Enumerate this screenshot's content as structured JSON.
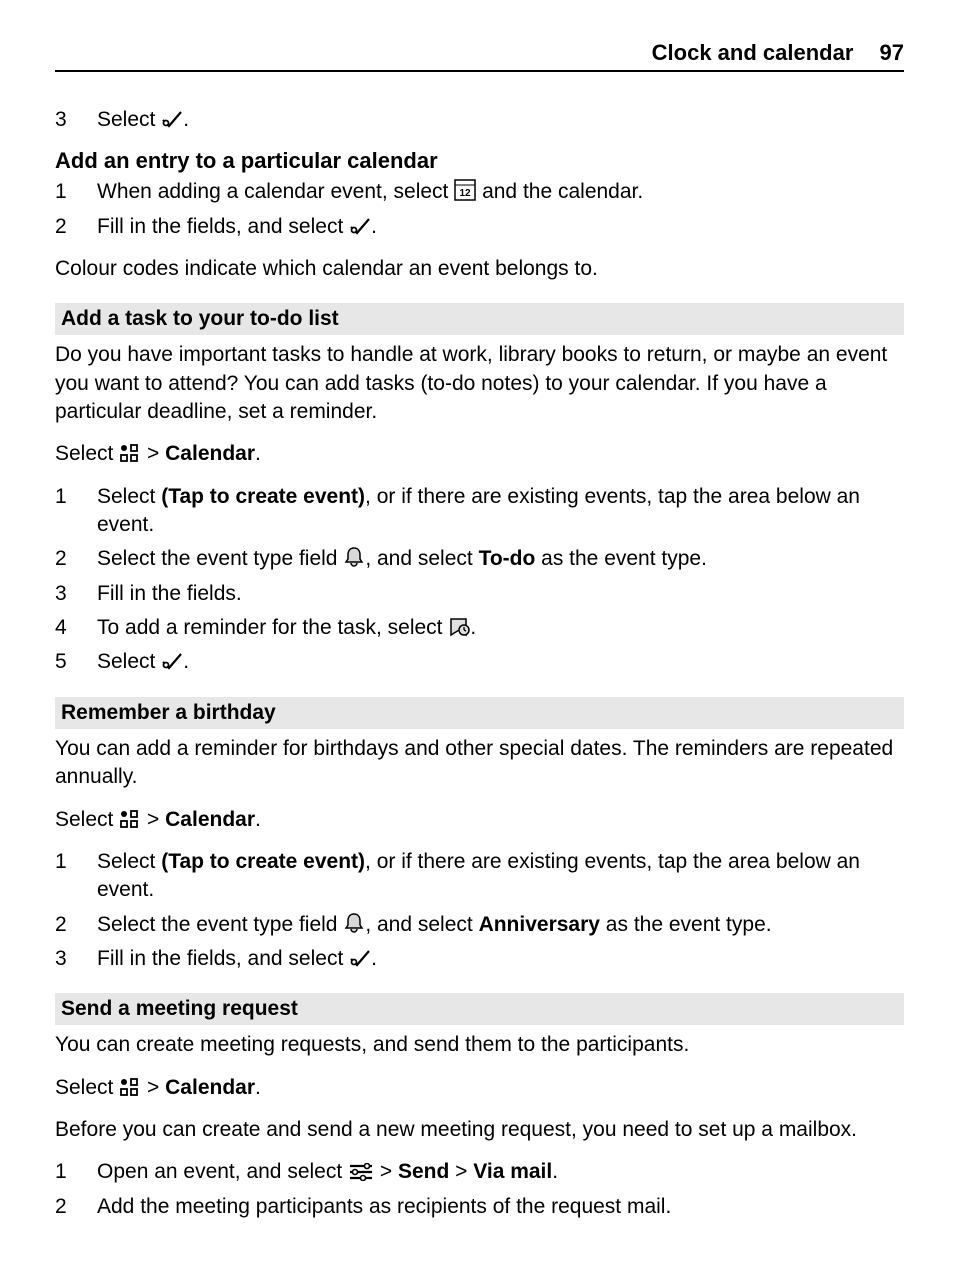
{
  "header": {
    "title": "Clock and calendar",
    "page": "97"
  },
  "pre_ol": [
    {
      "num": "3",
      "parts": [
        {
          "t": "Select "
        },
        {
          "icon": "check"
        },
        {
          "t": "."
        }
      ]
    }
  ],
  "add_entry_heading": "Add an entry to a particular calendar",
  "add_entry_ol": [
    {
      "num": "1",
      "parts": [
        {
          "t": "When adding a calendar event, select "
        },
        {
          "icon": "calendar12"
        },
        {
          "t": " and the calendar."
        }
      ]
    },
    {
      "num": "2",
      "parts": [
        {
          "t": "Fill in the fields, and select "
        },
        {
          "icon": "check"
        },
        {
          "t": "."
        }
      ]
    }
  ],
  "colour_para": "Colour codes indicate which calendar an event belongs to.",
  "task_heading": "Add a task to your to-do list",
  "task_para": "Do you have important tasks to handle at work, library books to return, or maybe an event you want to attend? You can add tasks (to-do notes) to your calendar. If you have a particular deadline, set a reminder.",
  "select_menu_calendar": [
    {
      "t": "Select "
    },
    {
      "icon": "menu-grid"
    },
    {
      "t": " > "
    },
    {
      "t": "Calendar",
      "bold": true
    },
    {
      "t": "."
    }
  ],
  "task_ol": [
    {
      "num": "1",
      "parts": [
        {
          "t": "Select "
        },
        {
          "t": "(Tap to create event)",
          "bold": true
        },
        {
          "t": ", or if there are existing events, tap the area below an event."
        }
      ]
    },
    {
      "num": "2",
      "parts": [
        {
          "t": "Select the event type field "
        },
        {
          "icon": "bell"
        },
        {
          "t": ", and select "
        },
        {
          "t": "To-do",
          "bold": true
        },
        {
          "t": " as the event type."
        }
      ]
    },
    {
      "num": "3",
      "parts": [
        {
          "t": "Fill in the fields."
        }
      ]
    },
    {
      "num": "4",
      "parts": [
        {
          "t": "To add a reminder for the task, select "
        },
        {
          "icon": "reminder"
        },
        {
          "t": "."
        }
      ]
    },
    {
      "num": "5",
      "parts": [
        {
          "t": "Select "
        },
        {
          "icon": "check"
        },
        {
          "t": "."
        }
      ]
    }
  ],
  "birthday_heading": "Remember a birthday",
  "birthday_para": "You can add a reminder for birthdays and other special dates. The reminders are repeated annually.",
  "birthday_ol": [
    {
      "num": "1",
      "parts": [
        {
          "t": "Select "
        },
        {
          "t": "(Tap to create event)",
          "bold": true
        },
        {
          "t": ", or if there are existing events, tap the area below an event."
        }
      ]
    },
    {
      "num": "2",
      "parts": [
        {
          "t": "Select the event type field "
        },
        {
          "icon": "bell"
        },
        {
          "t": ", and select "
        },
        {
          "t": "Anniversary",
          "bold": true
        },
        {
          "t": " as the event type."
        }
      ]
    },
    {
      "num": "3",
      "parts": [
        {
          "t": "Fill in the fields, and select "
        },
        {
          "icon": "check"
        },
        {
          "t": "."
        }
      ]
    }
  ],
  "meeting_heading": "Send a meeting request",
  "meeting_para1": "You can create meeting requests, and send them to the participants.",
  "meeting_para2": "Before you can create and send a new meeting request, you need to set up a mailbox.",
  "meeting_ol": [
    {
      "num": "1",
      "parts": [
        {
          "t": "Open an event, and select "
        },
        {
          "icon": "options"
        },
        {
          "t": " > "
        },
        {
          "t": "Send",
          "bold": true
        },
        {
          "t": "  > "
        },
        {
          "t": "Via mail",
          "bold": true
        },
        {
          "t": "."
        }
      ]
    },
    {
      "num": "2",
      "parts": [
        {
          "t": "Add the meeting participants as recipients of the request mail."
        }
      ]
    }
  ]
}
